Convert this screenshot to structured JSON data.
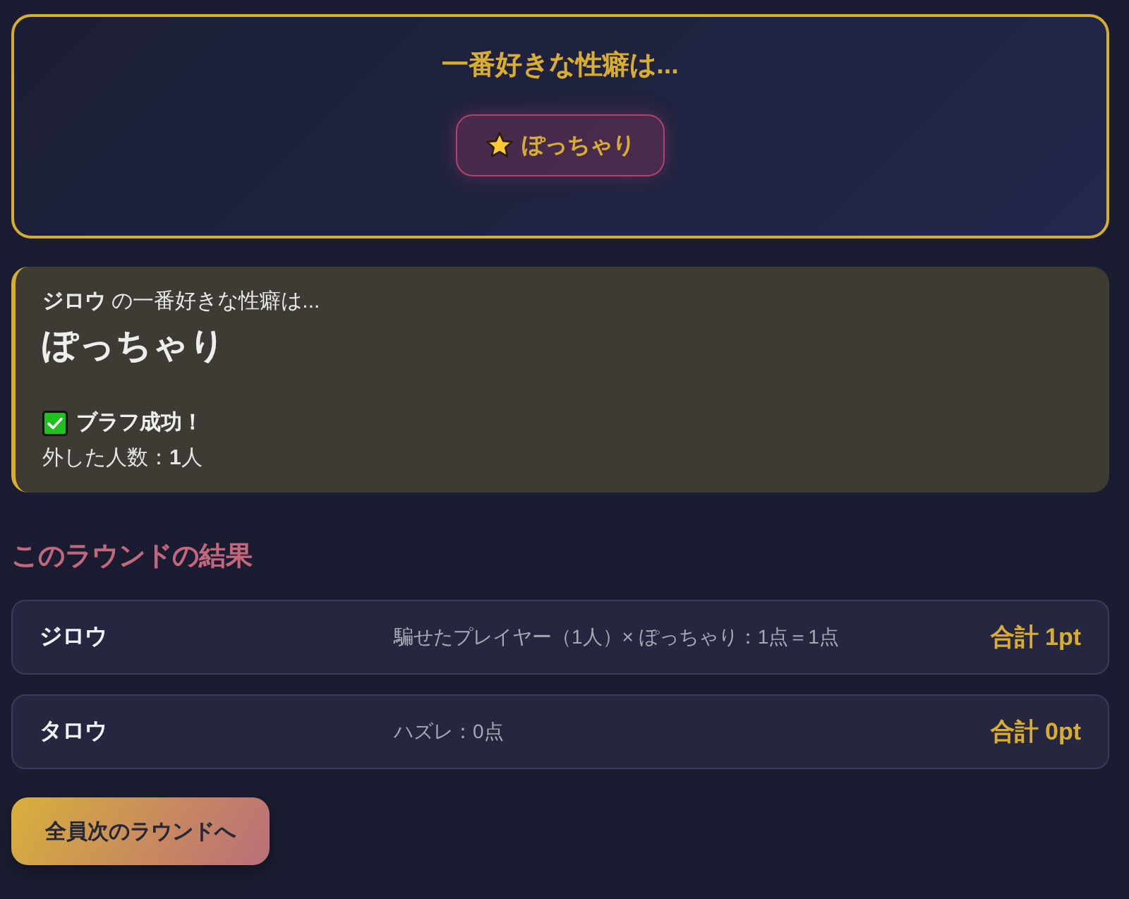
{
  "prompt": {
    "title": "一番好きな性癖は...",
    "choice": {
      "label": "ぽっちゃり",
      "selected": true
    }
  },
  "reveal": {
    "heading": "**ジロウ** の一番好きな性癖は...",
    "answer": "ぽっちゃり",
    "result": {
      "label": "ブラフ成功！",
      "success": true
    },
    "missed": "外した人数：**1**人"
  },
  "results": {
    "title": "このラウンドの結果",
    "rows": [
      {
        "name": "ジロウ",
        "detail": "騙せたプレイヤー（1人）× ぽっちゃり：1点＝1点",
        "total": "合計 1pt"
      },
      {
        "name": "タロウ",
        "detail": "ハズレ：0点",
        "total": "合計 0pt"
      }
    ]
  },
  "next_button": "全員次のラウンドへ"
}
